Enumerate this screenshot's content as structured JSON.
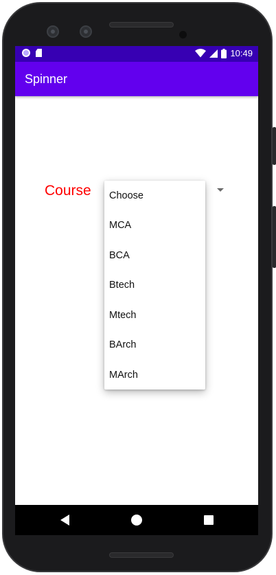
{
  "status_bar": {
    "time": "10:49",
    "left_icons": [
      "notification-circle-icon",
      "sd-card-icon"
    ],
    "right_icons": [
      "wifi-icon",
      "cell-signal-icon",
      "battery-icon"
    ]
  },
  "app_bar": {
    "title": "Spinner"
  },
  "form": {
    "label": "Course"
  },
  "spinner": {
    "options": [
      "Choose",
      "MCA",
      "BCA",
      "Btech",
      "Mtech",
      "BArch",
      "MArch"
    ]
  },
  "nav_bar": {
    "icons": [
      "back-icon",
      "home-icon",
      "recents-icon"
    ]
  },
  "colors": {
    "status_bar": "#3700b3",
    "app_bar": "#6200ee",
    "label": "#ff0000"
  }
}
